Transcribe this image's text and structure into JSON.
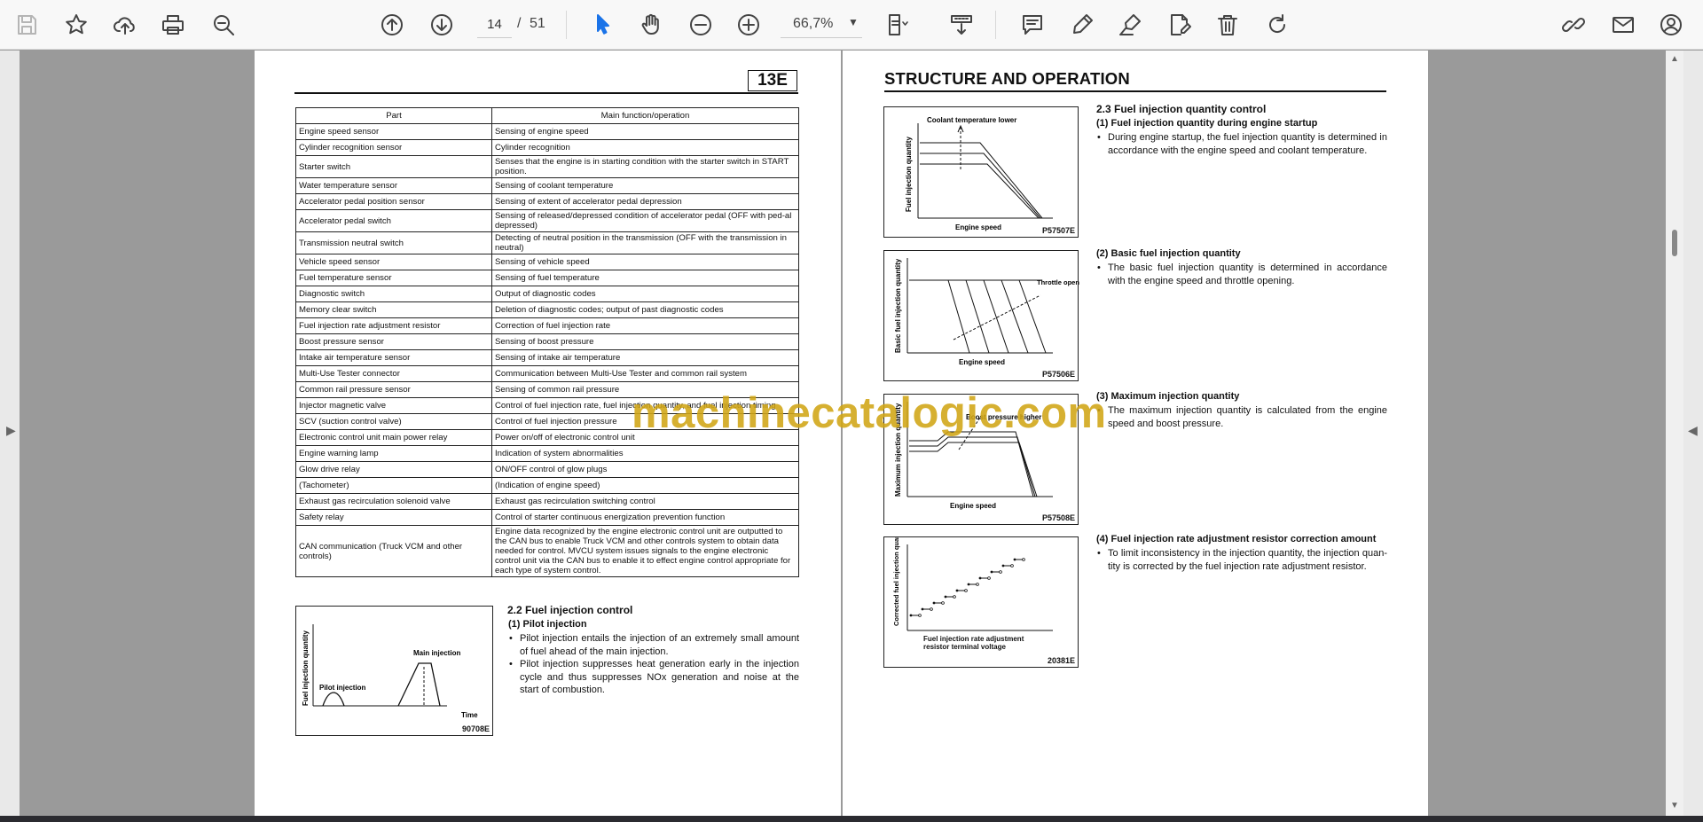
{
  "toolbar": {
    "current_page": "14",
    "page_separator": "/",
    "total_pages": "51",
    "zoom": "66,7%"
  },
  "left_page": {
    "section_tag": "13E",
    "table": {
      "headers": [
        "Part",
        "Main function/operation"
      ],
      "rows": [
        [
          "Engine speed sensor",
          "Sensing of engine speed"
        ],
        [
          "Cylinder recognition sensor",
          "Cylinder recognition"
        ],
        [
          "Starter switch",
          "Senses that the engine is in starting condition with the starter switch in START position."
        ],
        [
          "Water temperature sensor",
          "Sensing of coolant temperature"
        ],
        [
          "Accelerator pedal position sensor",
          "Sensing of extent of accelerator pedal depression"
        ],
        [
          "Accelerator pedal switch",
          "Sensing of released/depressed condition of accelerator pedal (OFF with ped-al depressed)"
        ],
        [
          "Transmission neutral switch",
          "Detecting of neutral position in the transmission (OFF with the transmission in neutral)"
        ],
        [
          "Vehicle speed sensor",
          "Sensing of vehicle speed"
        ],
        [
          "Fuel temperature sensor",
          "Sensing of fuel temperature"
        ],
        [
          "Diagnostic switch",
          "Output of diagnostic codes"
        ],
        [
          "Memory clear switch",
          "Deletion of diagnostic codes; output of past diagnostic codes"
        ],
        [
          "Fuel injection rate adjustment resistor",
          "Correction of fuel injection rate"
        ],
        [
          "Boost pressure sensor",
          "Sensing of boost pressure"
        ],
        [
          "Intake air temperature sensor",
          "Sensing of intake air temperature"
        ],
        [
          "Multi-Use Tester connector",
          "Communication between Multi-Use Tester and common rail system"
        ],
        [
          "Common rail pressure sensor",
          "Sensing of common rail pressure"
        ],
        [
          "Injector magnetic valve",
          "Control of fuel injection rate, fuel injection quantity, and fuel injection timing"
        ],
        [
          "SCV (suction control valve)",
          "Control of fuel injection pressure"
        ],
        [
          "Electronic control unit main power relay",
          "Power on/off of electronic control unit"
        ],
        [
          "Engine warning lamp",
          "Indication of system abnormalities"
        ],
        [
          "Glow drive relay",
          "ON/OFF control of glow plugs"
        ],
        [
          "(Tachometer)",
          "(Indication of engine speed)"
        ],
        [
          "Exhaust gas recirculation solenoid valve",
          "Exhaust gas recirculation switching control"
        ],
        [
          "Safety relay",
          "Control of starter continuous energization prevention function"
        ],
        [
          "CAN communication (Truck VCM and other controls)",
          "Engine data recognized by the engine electronic control unit are outputted to the CAN bus to enable Truck VCM and other controls system to obtain data needed for control. MVCU system issues signals to the engine electronic control unit via the CAN bus to enable it to effect engine control appropriate for each type of system control."
        ]
      ]
    },
    "pilot_fig": {
      "ylabel": "Fuel injection quantity",
      "main_label": "Main injection",
      "pilot_label": "Pilot injection",
      "xlabel": "Time",
      "code": "90708E"
    },
    "section_2_2": {
      "heading": "2.2  Fuel injection control",
      "sub": "(1)  Pilot injection",
      "bullets": [
        "Pilot injection entails the injection of an extremely small amount of fuel ahead of the main injection.",
        "Pilot injection suppresses heat generation early in the injection cycle and thus suppresses NOx generation and noise at the start of combustion."
      ]
    }
  },
  "right_page": {
    "title": "STRUCTURE AND OPERATION",
    "fig1": {
      "annotation": "Coolant temperature lower",
      "ylabel": "Fuel injection quantity",
      "xlabel": "Engine speed",
      "code": "P57507E"
    },
    "fig2": {
      "annotation": "Throttle opening",
      "ylabel": "Basic fuel injection quantity",
      "xlabel": "Engine speed",
      "code": "P57506E"
    },
    "fig3": {
      "annotation": "Boost pressure higher",
      "ylabel": "Maximum injection quantity",
      "xlabel": "Engine speed",
      "code": "P57508E"
    },
    "fig4": {
      "ylabel": "Corrected fuel injection quantity",
      "xlabel": "Fuel injection rate adjustment resistor terminal voltage",
      "code": "20381E"
    },
    "section_2_3": {
      "heading": "2.3  Fuel injection quantity control",
      "s1_heading": "(1)  Fuel injection quantity during engine startup",
      "s1_text": "During engine startup, the fuel injection quantity is determined in accordance with the engine speed and coolant temperature.",
      "s2_heading": "(2)  Basic fuel injection quantity",
      "s2_text": "The basic fuel injection quantity is determined in accordance with the engine speed and throttle opening.",
      "s3_heading": "(3)  Maximum injection quantity",
      "s3_text": "The maximum injection quantity is calculated from the engine speed and boost pressure.",
      "s4_heading": "(4)  Fuel injection rate adjustment resistor correction amount",
      "s4_text": "To limit inconsistency in the injection quantity, the injection quan-tity is corrected by the fuel injection rate adjustment resistor."
    }
  },
  "watermark": "machinecatalogic.com"
}
